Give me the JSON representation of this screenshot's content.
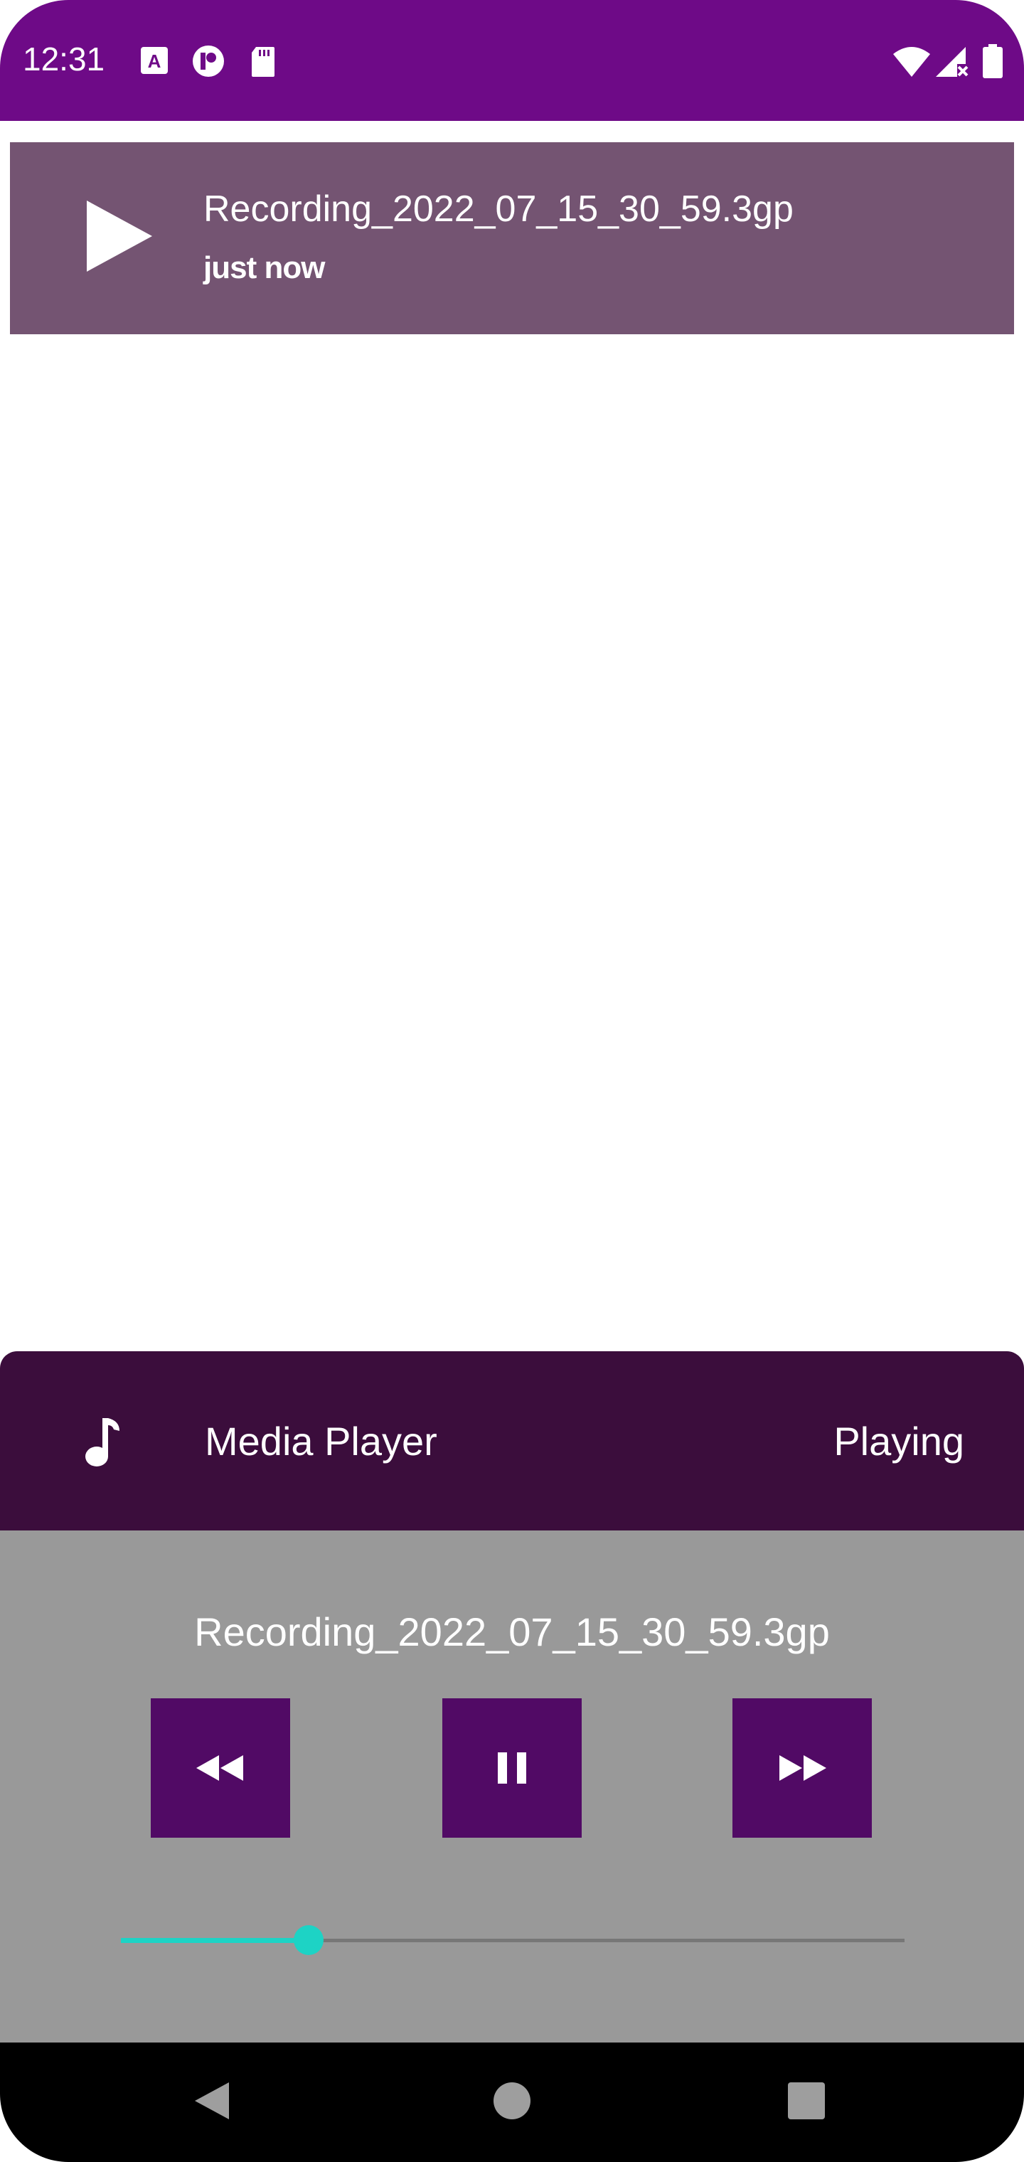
{
  "status_bar": {
    "time": "12:31",
    "left_icons": [
      "text-a-icon",
      "p-app-icon",
      "sd-card-icon"
    ],
    "right_icons": [
      "wifi-icon",
      "signal-no-service-icon",
      "battery-icon"
    ],
    "background": "#6e0a87"
  },
  "recordings": [
    {
      "name": "Recording_2022_07_15_30_59.3gp",
      "time": "just now"
    }
  ],
  "player": {
    "title": "Media Player",
    "status": "Playing",
    "now_playing": "Recording_2022_07_15_30_59.3gp",
    "progress": 0.24,
    "controls": [
      "rewind-icon",
      "pause-icon",
      "fast-forward-icon"
    ],
    "colors": {
      "header": "#3b0d3c",
      "body": "#999999",
      "button": "#510a65",
      "accent": "#1dd3c5",
      "list_item": "#745472"
    }
  },
  "nav_bar": {
    "buttons": [
      "back-icon",
      "home-icon",
      "recents-icon"
    ]
  }
}
